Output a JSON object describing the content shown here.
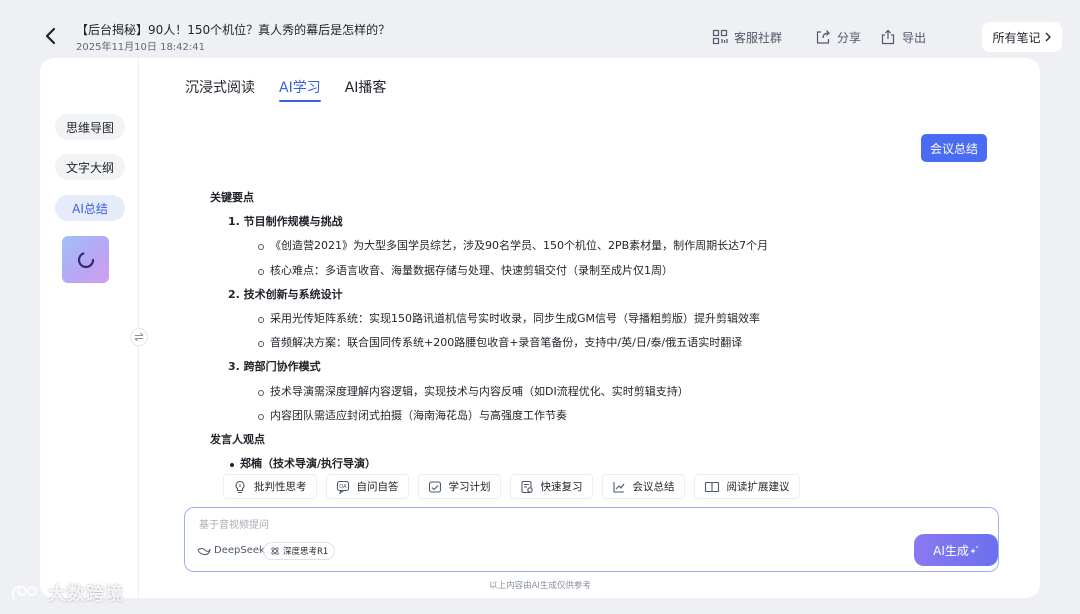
{
  "header": {
    "title": "【后台揭秘】90人！150个机位？真人秀的幕后是怎样的？",
    "datetime": "2025年11月10日 18:42:41",
    "actions": [
      {
        "label": "客服社群",
        "icon": "qr-group-icon"
      },
      {
        "label": "分享",
        "icon": "share-icon"
      },
      {
        "label": "导出",
        "icon": "export-icon"
      }
    ],
    "all_notes": "所有笔记",
    "all_notes_icon": "chevron-right-icon"
  },
  "sidebar": {
    "items": [
      {
        "label": "思维导图",
        "active": false
      },
      {
        "label": "文字大纲",
        "active": false
      },
      {
        "label": "AI总结",
        "active": true
      }
    ],
    "thumbnail_icon": "loading-spinner-icon",
    "collapse_icon": "swap-icon"
  },
  "tabs": [
    {
      "label": "沉浸式阅读",
      "active": false
    },
    {
      "label": "AI学习",
      "active": true
    },
    {
      "label": "AI播客",
      "active": false
    }
  ],
  "meeting_button": "会议总结",
  "content": {
    "heading_key_points": "关键要点",
    "sections": [
      {
        "title": "1. 节目制作规模与挑战",
        "bullets": [
          "《创造营2021》为大型多国学员综艺，涉及90名学员、150个机位、2PB素材量，制作周期长达7个月",
          "核心难点：多语言收音、海量数据存储与处理、快速剪辑交付（录制至成片仅1周）"
        ]
      },
      {
        "title": "2. 技术创新与系统设计",
        "bullets": [
          "采用光传矩阵系统：实现150路讯道机信号实时收录，同步生成GM信号（导播粗剪版）提升剪辑效率",
          "音频解决方案：联合国同传系统+200路腰包收音+录音笔备份，支持中/英/日/泰/俄五语实时翻译"
        ]
      },
      {
        "title": "3. 跨部门协作模式",
        "bullets": [
          "技术导演需深度理解内容逻辑，实现技术与内容反哺（如DI流程优化、实时剪辑支持）",
          "内容团队需适应封闭式拍摄（海南海花岛）与高强度工作节奏"
        ]
      }
    ],
    "heading_speakers": "发言人观点",
    "speaker": "郑楠（技术导演/执行导演）"
  },
  "quick_actions": [
    {
      "label": "批判性思考",
      "icon": "bulb-icon"
    },
    {
      "label": "自问自答",
      "icon": "qa-icon"
    },
    {
      "label": "学习计划",
      "icon": "plan-icon"
    },
    {
      "label": "快速复习",
      "icon": "review-icon"
    },
    {
      "label": "会议总结",
      "icon": "chart-icon"
    },
    {
      "label": "阅读扩展建议",
      "icon": "book-icon"
    }
  ],
  "input": {
    "placeholder": "基于音视频提问",
    "model": "DeepSeek",
    "model_icon": "deepseek-whale-icon",
    "think_tag": "深度思考R1",
    "think_icon": "atom-icon",
    "generate_label": "AI生成",
    "generate_icon": "sparkle-icon"
  },
  "disclaimer": "以上内容由AI生成仅供参考",
  "watermark": "大数跨境",
  "colors": {
    "accent": "#3a5de0",
    "button_blue": "#4a6cf2",
    "generate_gradient_start": "#8a78f2",
    "generate_gradient_end": "#6a70ee",
    "page_bg": "#eef0f4"
  }
}
